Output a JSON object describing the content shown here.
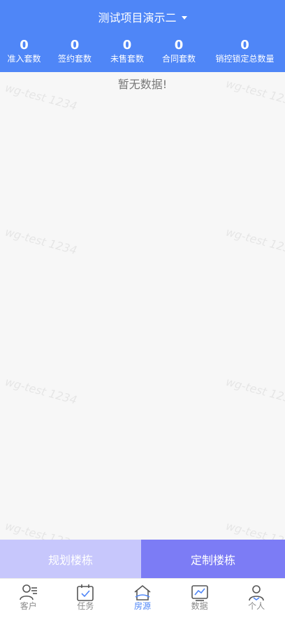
{
  "header": {
    "project_title": "测试项目演示二",
    "stats": [
      {
        "value": "0",
        "label": "准入套数"
      },
      {
        "value": "0",
        "label": "签约套数"
      },
      {
        "value": "0",
        "label": "未售套数"
      },
      {
        "value": "0",
        "label": "合同套数"
      },
      {
        "value": "0",
        "label": "销控锁定总数量"
      }
    ]
  },
  "content": {
    "empty_text": "暂无数据!",
    "watermark": "wg-test 1234"
  },
  "actions": {
    "plan_label": "规划楼栋",
    "custom_label": "定制楼栋"
  },
  "tabbar": {
    "items": [
      {
        "label": "客户",
        "icon": "customer-icon"
      },
      {
        "label": "任务",
        "icon": "task-icon"
      },
      {
        "label": "房源",
        "icon": "house-icon"
      },
      {
        "label": "数据",
        "icon": "chart-icon"
      },
      {
        "label": "个人",
        "icon": "person-icon"
      }
    ]
  },
  "colors": {
    "primary": "#4f86f7",
    "button_light": "#c7c7fc",
    "button_dark": "#7c7cf5"
  }
}
